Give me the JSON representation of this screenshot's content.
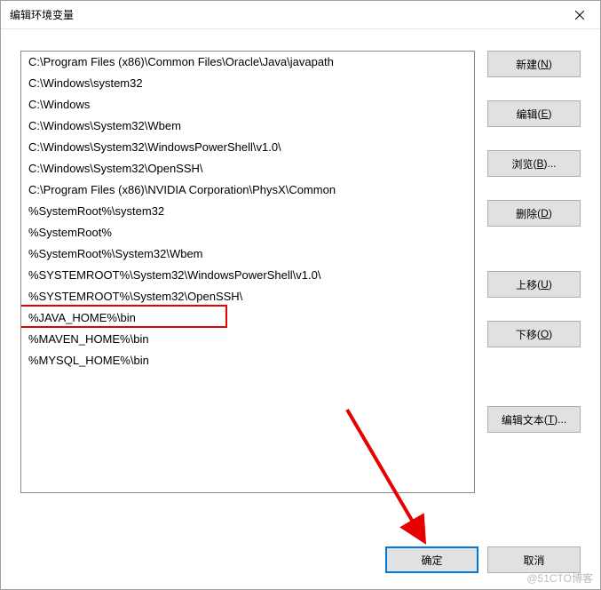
{
  "window": {
    "title": "编辑环境变量"
  },
  "list": {
    "items": [
      "C:\\Program Files (x86)\\Common Files\\Oracle\\Java\\javapath",
      "C:\\Windows\\system32",
      "C:\\Windows",
      "C:\\Windows\\System32\\Wbem",
      "C:\\Windows\\System32\\WindowsPowerShell\\v1.0\\",
      "C:\\Windows\\System32\\OpenSSH\\",
      "C:\\Program Files (x86)\\NVIDIA Corporation\\PhysX\\Common",
      "%SystemRoot%\\system32",
      "%SystemRoot%",
      "%SystemRoot%\\System32\\Wbem",
      "%SYSTEMROOT%\\System32\\WindowsPowerShell\\v1.0\\",
      "%SYSTEMROOT%\\System32\\OpenSSH\\",
      "%JAVA_HOME%\\bin",
      "%MAVEN_HOME%\\bin",
      "%MYSQL_HOME%\\bin"
    ]
  },
  "buttons": {
    "new": "新建",
    "new_key": "N",
    "edit": "编辑",
    "edit_key": "E",
    "browse": "浏览",
    "browse_key": "B",
    "delete": "删除",
    "delete_key": "D",
    "moveup": "上移",
    "moveup_key": "U",
    "movedown": "下移",
    "movedown_key": "O",
    "edittext": "编辑文本",
    "edittext_key": "T",
    "ok": "确定",
    "cancel": "取消"
  },
  "watermark": "@51CTO博客"
}
